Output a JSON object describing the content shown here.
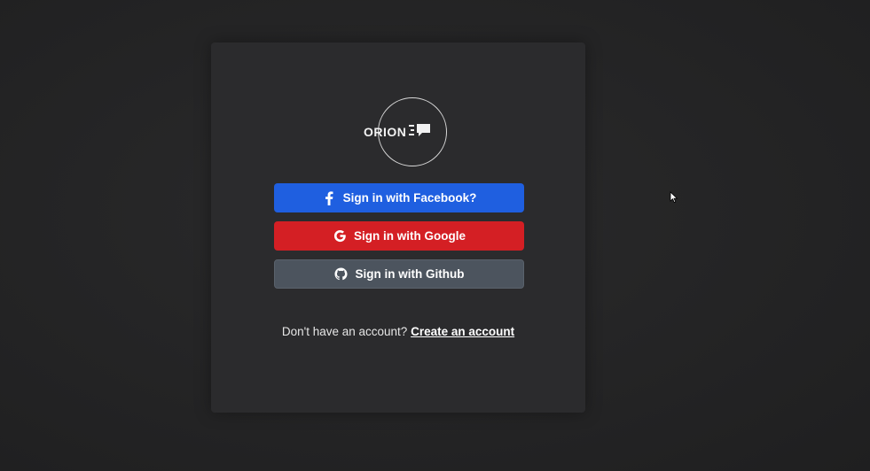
{
  "brand": {
    "name": "ORION",
    "logo_icon": "chat-bubble-lines-icon"
  },
  "buttons": {
    "facebook": {
      "label": "Sign in with Facebook?",
      "icon": "facebook-icon",
      "color": "#1f5fe0"
    },
    "google": {
      "label": "Sign in with Google",
      "icon": "google-icon",
      "color": "#d41f24"
    },
    "github": {
      "label": "Sign in with Github",
      "icon": "github-icon",
      "color": "#4c545e"
    }
  },
  "footer": {
    "prompt": "Don't have an account?",
    "link": "Create an account"
  },
  "colors": {
    "background": "#242424",
    "panel": "#2b2b2d",
    "text": "#e6e6e6"
  }
}
